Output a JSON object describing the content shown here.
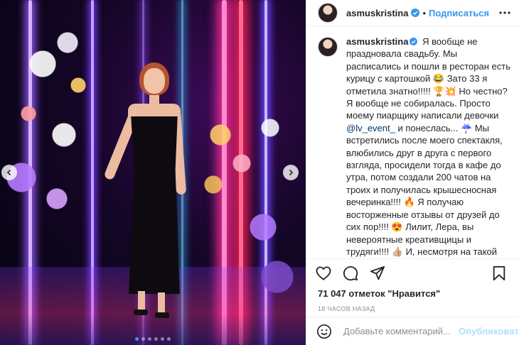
{
  "header": {
    "username": "asmuskristina",
    "separator": "•",
    "follow_label": "Подписаться"
  },
  "caption": {
    "username": "asmuskristina",
    "text_part1": "Я вообще не праздновала свадьбу. Мы расписались и пошли в ресторан есть курицу с картошкой 😂 Зато 33 я отметила знатно!!!!! 🏆💥 Но честно? Я вообще не собиралась. Просто моему пиарщику написали девочки ",
    "mention": "@lv_event_",
    "text_part2": " и понеслась... ☔ Мы встретились после моего спектакля, влюбились друг в друга с первого взгляда, просидели тогда в кафе до утра, потом создали 200 чатов на троих и получилась крышесносная вечеринка!!!! 🔥 Я получаю восторженные отзывы от друзей до сих пор!!!! 😍 Лилит, Лера, вы невероятные креативщицы и трудяги!!!! 👍🏼 И, несмотря на такой громадный опыт и звездный послужной список,"
  },
  "likes": {
    "count": "71 047",
    "label_prefix": " отметок ",
    "label_word": "\"Нравится\""
  },
  "timestamp": "18 ЧАСОВ НАЗАД",
  "comment": {
    "placeholder": "Добавьте комментарий...",
    "publish_label": "Опубликовать"
  },
  "carousel": {
    "total_dots": 6,
    "active_index": 0
  },
  "colors": {
    "accent": "#3897f0",
    "publish_disabled": "#b2dffc",
    "muted": "#8e8e8e"
  },
  "icons": {
    "verified": "verified-badge-icon",
    "more": "more-dots-icon",
    "like": "heart-icon",
    "comment": "comment-bubble-icon",
    "share": "share-plane-icon",
    "save": "bookmark-icon",
    "emoji": "smiley-icon",
    "prev": "chevron-left-icon",
    "next": "chevron-right-icon"
  }
}
